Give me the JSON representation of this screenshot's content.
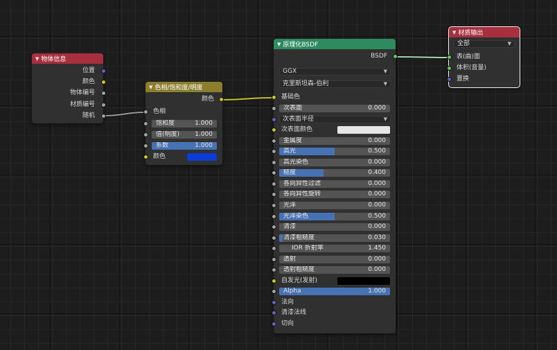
{
  "colors": {
    "object_info_header": "#a72f3e",
    "hsv_header": "#8b7e2d",
    "bsdf_header": "#2e8b5f",
    "output_header": "#a72f3e",
    "field_fill": "#4772b3",
    "socket_color": "#c7c729",
    "socket_float": "#a1a1a1",
    "socket_vector": "#6363c7",
    "socket_shader": "#63c763"
  },
  "object_info": {
    "title": "物体信息",
    "outputs": [
      "位置",
      "颜色",
      "物体编号",
      "材质编号",
      "随机"
    ]
  },
  "hsv": {
    "title": "色相/饱和度/明度",
    "output": "颜色",
    "hue_label": "色相",
    "fields": [
      {
        "label": "饱和度",
        "value": "1.000",
        "fraction": 0
      },
      {
        "label": "值(明度)",
        "value": "1.000",
        "fraction": 0
      },
      {
        "label": "系数",
        "value": "1.000",
        "fraction": 1
      }
    ],
    "color_label": "颜色",
    "color_value": "#0a3dd8"
  },
  "bsdf": {
    "title": "原理化BSDF",
    "output": "BSDF",
    "distribution": "GGX",
    "subsurface_method": "克里斯坦森-伯利",
    "base_color_label": "基础色",
    "rows": [
      {
        "type": "field",
        "label": "次表面",
        "value": "0.000",
        "fraction": 0,
        "socket": "gray"
      },
      {
        "type": "dropdown",
        "label": "次表面半径",
        "socket": "blue"
      },
      {
        "type": "color",
        "label": "次表面颜色",
        "color": "#e6e6e6",
        "socket": "yellow"
      },
      {
        "type": "field",
        "label": "金属度",
        "value": "0.000",
        "fraction": 0,
        "socket": "gray"
      },
      {
        "type": "field",
        "label": "高光",
        "value": "0.500",
        "fraction": 0.5,
        "socket": "gray"
      },
      {
        "type": "field",
        "label": "高光染色",
        "value": "0.000",
        "fraction": 0,
        "socket": "gray"
      },
      {
        "type": "field",
        "label": "糙度",
        "value": "0.400",
        "fraction": 0.4,
        "socket": "gray"
      },
      {
        "type": "field",
        "label": "各向异性过滤",
        "value": "0.000",
        "fraction": 0,
        "socket": "gray"
      },
      {
        "type": "field",
        "label": "各向异性旋转",
        "value": "0.000",
        "fraction": 0,
        "socket": "gray"
      },
      {
        "type": "field",
        "label": "光泽",
        "value": "0.000",
        "fraction": 0,
        "socket": "gray"
      },
      {
        "type": "field",
        "label": "光泽染色",
        "value": "0.500",
        "fraction": 0.5,
        "socket": "gray"
      },
      {
        "type": "field",
        "label": "清漆",
        "value": "0.000",
        "fraction": 0,
        "socket": "gray"
      },
      {
        "type": "field",
        "label": "清漆粗糙度",
        "value": "0.030",
        "fraction": 0.03,
        "socket": "gray"
      },
      {
        "type": "field",
        "label": "IOR 折射率",
        "value": "1.450",
        "fraction": 0,
        "socket": "gray",
        "indent": true
      },
      {
        "type": "field",
        "label": "透射",
        "value": "0.000",
        "fraction": 0,
        "socket": "gray"
      },
      {
        "type": "field",
        "label": "透射粗糙度",
        "value": "0.000",
        "fraction": 0,
        "socket": "gray"
      },
      {
        "type": "color",
        "label": "自发光(发射)",
        "color": "#000000",
        "socket": "yellow"
      },
      {
        "type": "field",
        "label": "Alpha",
        "value": "1.000",
        "fraction": 1,
        "socket": "gray"
      },
      {
        "type": "label",
        "label": "法向",
        "socket": "blue"
      },
      {
        "type": "label",
        "label": "清漆法线",
        "socket": "blue"
      },
      {
        "type": "label",
        "label": "切向",
        "socket": "blue"
      }
    ]
  },
  "output": {
    "title": "材质输出",
    "target": "全部",
    "inputs": [
      {
        "label": "表(曲)面",
        "socket": "green"
      },
      {
        "label": "体积(音量)",
        "socket": "green"
      },
      {
        "label": "置换",
        "socket": "blue"
      }
    ]
  }
}
